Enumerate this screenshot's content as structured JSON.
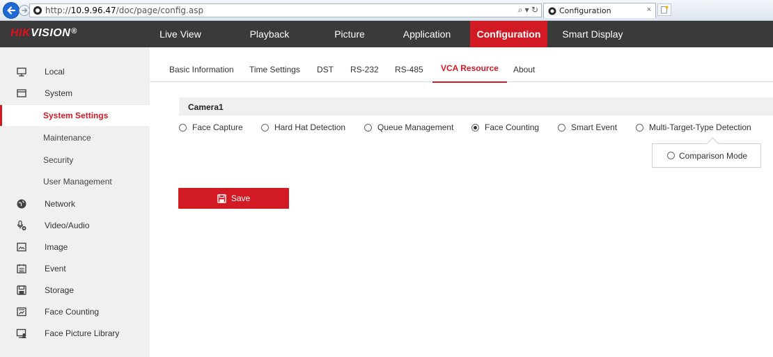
{
  "browser": {
    "url_scheme": "http://",
    "url_host": "10.9.96.47",
    "url_path": "/doc/page/config.asp",
    "address_actions": "⌕ ▾ ↻",
    "tab_title": "Configuration",
    "tab_close": "×"
  },
  "header": {
    "logo_hik": "HIK",
    "logo_vision": "VISION",
    "logo_reg": "®",
    "nav": [
      "Live View",
      "Playback",
      "Picture",
      "Application",
      "Configuration",
      "Smart Display"
    ],
    "active_nav": "Configuration"
  },
  "sidebar": {
    "items": [
      {
        "label": "Local",
        "icon": "monitor-icon"
      },
      {
        "label": "System",
        "icon": "window-icon"
      },
      {
        "label": "System Settings",
        "sub": true,
        "active": true
      },
      {
        "label": "Maintenance",
        "sub": true
      },
      {
        "label": "Security",
        "sub": true
      },
      {
        "label": "User Management",
        "sub": true
      },
      {
        "label": "Network",
        "icon": "globe-icon"
      },
      {
        "label": "Video/Audio",
        "icon": "mic-camera-icon"
      },
      {
        "label": "Image",
        "icon": "image-icon"
      },
      {
        "label": "Event",
        "icon": "calendar-icon"
      },
      {
        "label": "Storage",
        "icon": "disk-icon"
      },
      {
        "label": "Face Counting",
        "icon": "chart-icon"
      },
      {
        "label": "Face Picture Library",
        "icon": "face-library-icon"
      }
    ]
  },
  "tabs": {
    "items": [
      "Basic Information",
      "Time Settings",
      "DST",
      "RS-232",
      "RS-485",
      "VCA Resource",
      "About"
    ],
    "active": "VCA Resource"
  },
  "camera": {
    "title": "Camera1",
    "options": [
      {
        "label": "Face Capture",
        "selected": false
      },
      {
        "label": "Hard Hat Detection",
        "selected": false
      },
      {
        "label": "Queue Management",
        "selected": false
      },
      {
        "label": "Face Counting",
        "selected": true
      },
      {
        "label": "Smart Event",
        "selected": false
      },
      {
        "label": "Multi-Target-Type Detection",
        "selected": false
      }
    ],
    "sub_option": "Comparison Mode"
  },
  "save_label": "Save",
  "colors": {
    "accent": "#d21a24",
    "header_bg": "#3a3a3a",
    "sidebar_bg": "#f0f0f0"
  }
}
